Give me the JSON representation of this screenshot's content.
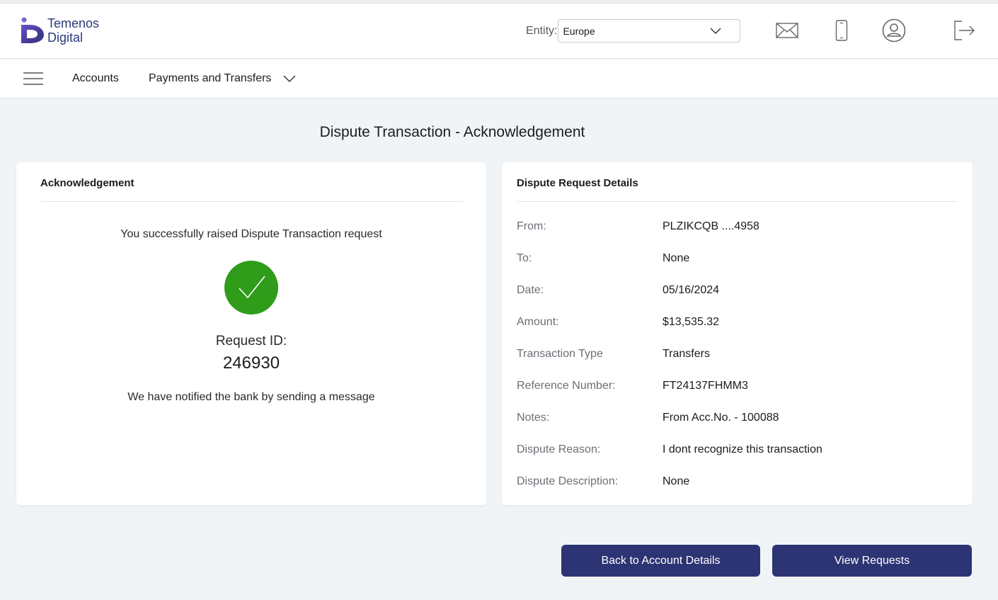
{
  "brand": {
    "line1": "Temenos",
    "line2": "Digital",
    "logo_color": "#2c3a7a"
  },
  "header": {
    "entity_label": "Entity:",
    "entity_value": "Europe",
    "icons": [
      "mail-icon",
      "mobile-icon",
      "profile-icon",
      "logout-icon"
    ]
  },
  "nav": {
    "menu_icon": "hamburger-icon",
    "items": [
      "Accounts",
      "Payments and Transfers"
    ]
  },
  "page": {
    "title": "Dispute Transaction - Acknowledgement"
  },
  "ack": {
    "heading": "Acknowledgement",
    "message": "You successfully raised Dispute Transaction request",
    "request_id_label": "Request ID:",
    "request_id": "246930",
    "notify": "We have notified the bank by sending a message",
    "success_color": "#2f9c1a"
  },
  "details": {
    "heading": "Dispute Request Details",
    "rows": [
      {
        "label": "From:",
        "value": "PLZIKCQB ....4958"
      },
      {
        "label": "To:",
        "value": "None"
      },
      {
        "label": "Date:",
        "value": "05/16/2024"
      },
      {
        "label": "Amount:",
        "value": "$13,535.32"
      },
      {
        "label": "Transaction Type",
        "value": "Transfers"
      },
      {
        "label": "Reference Number:",
        "value": "FT24137FHMM3"
      },
      {
        "label": "Notes:",
        "value": "From Acc.No. - 100088"
      },
      {
        "label": "Dispute Reason:",
        "value": "I dont recognize this transaction"
      },
      {
        "label": "Dispute Description:",
        "value": "None"
      }
    ]
  },
  "actions": {
    "back_label": "Back to Account Details",
    "view_label": "View Requests",
    "button_color": "#2d3474"
  }
}
